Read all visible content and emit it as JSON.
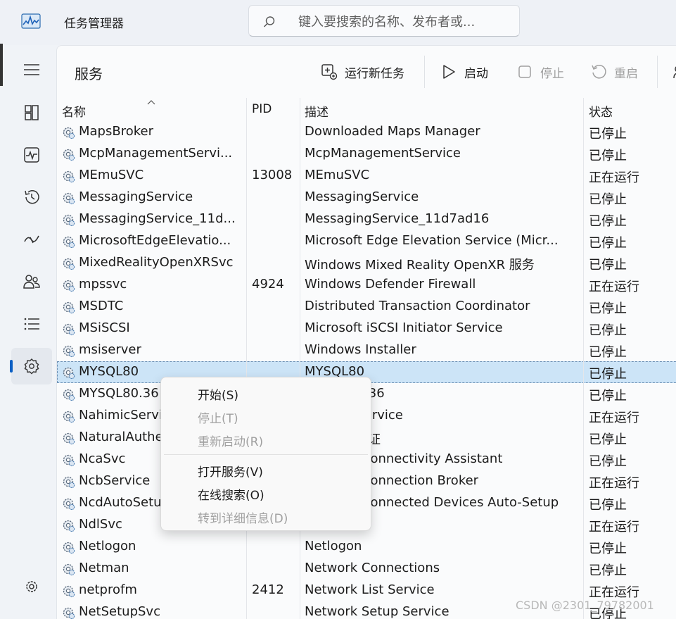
{
  "app": {
    "title": "任务管理器"
  },
  "search": {
    "placeholder": "键入要搜索的名称、发布者或..."
  },
  "page": {
    "title": "服务"
  },
  "toolbar": {
    "run_new_task": "运行新任务",
    "start": "启动",
    "stop": "停止",
    "restart": "重启"
  },
  "nav": {
    "icons": [
      "hamburger-menu-icon",
      "processes-icon",
      "performance-icon",
      "app-history-icon",
      "startup-apps-icon",
      "users-icon",
      "details-icon",
      "services-icon",
      "settings-icon"
    ]
  },
  "table": {
    "headers": {
      "name": "名称",
      "pid": "PID",
      "desc": "描述",
      "status": "状态"
    },
    "rows": [
      {
        "name": "MapsBroker",
        "pid": "",
        "desc": "Downloaded Maps Manager",
        "status": "已停止"
      },
      {
        "name": "McpManagementServi...",
        "pid": "",
        "desc": "McpManagementService",
        "status": "已停止"
      },
      {
        "name": "MEmuSVC",
        "pid": "13008",
        "desc": "MEmuSVC",
        "status": "正在运行"
      },
      {
        "name": "MessagingService",
        "pid": "",
        "desc": "MessagingService",
        "status": "已停止"
      },
      {
        "name": "MessagingService_11d...",
        "pid": "",
        "desc": "MessagingService_11d7ad16",
        "status": "已停止"
      },
      {
        "name": "MicrosoftEdgeElevatio...",
        "pid": "",
        "desc": "Microsoft Edge Elevation Service (Micr...",
        "status": "已停止"
      },
      {
        "name": "MixedRealityOpenXRSvc",
        "pid": "",
        "desc": "Windows Mixed Reality OpenXR 服务",
        "status": "已停止"
      },
      {
        "name": "mpssvc",
        "pid": "4924",
        "desc": "Windows Defender Firewall",
        "status": "正在运行"
      },
      {
        "name": "MSDTC",
        "pid": "",
        "desc": "Distributed Transaction Coordinator",
        "status": "已停止"
      },
      {
        "name": "MSiSCSI",
        "pid": "",
        "desc": "Microsoft iSCSI Initiator Service",
        "status": "已停止"
      },
      {
        "name": "msiserver",
        "pid": "",
        "desc": "Windows Installer",
        "status": "已停止"
      },
      {
        "name": "MYSQL80",
        "pid": "",
        "desc": "MYSQL80",
        "status": "已停止",
        "selected": true
      },
      {
        "name": "MYSQL80.36",
        "pid": "",
        "desc": "MYSQL80.36",
        "status": "已停止"
      },
      {
        "name": "NahimicService",
        "pid": "",
        "desc": "NahimicService",
        "status": "正在运行"
      },
      {
        "name": "NaturalAuthentication",
        "pid": "",
        "desc": "自然身份验证",
        "status": "已停止"
      },
      {
        "name": "NcaSvc",
        "pid": "",
        "desc": "Network Connectivity Assistant",
        "status": "已停止"
      },
      {
        "name": "NcbService",
        "pid": "",
        "desc": "Network Connection Broker",
        "status": "正在运行"
      },
      {
        "name": "NcdAutoSetup",
        "pid": "",
        "desc": "Network Connected Devices Auto-Setup",
        "status": "已停止"
      },
      {
        "name": "NdlSvc",
        "pid": "",
        "desc": "",
        "status": "正在运行"
      },
      {
        "name": "Netlogon",
        "pid": "",
        "desc": "Netlogon",
        "status": "已停止"
      },
      {
        "name": "Netman",
        "pid": "",
        "desc": "Network Connections",
        "status": "已停止"
      },
      {
        "name": "netprofm",
        "pid": "2412",
        "desc": "Network List Service",
        "status": "正在运行"
      },
      {
        "name": "NetSetupSvc",
        "pid": "",
        "desc": "Network Setup Service",
        "status": "已停止"
      }
    ]
  },
  "context_menu": {
    "start": "开始(S)",
    "stop": "停止(T)",
    "restart": "重新启动(R)",
    "open_services": "打开服务(V)",
    "search_online": "在线搜索(O)",
    "go_to_details": "转到详细信息(D)"
  },
  "watermark": "CSDN @2301_79782001"
}
